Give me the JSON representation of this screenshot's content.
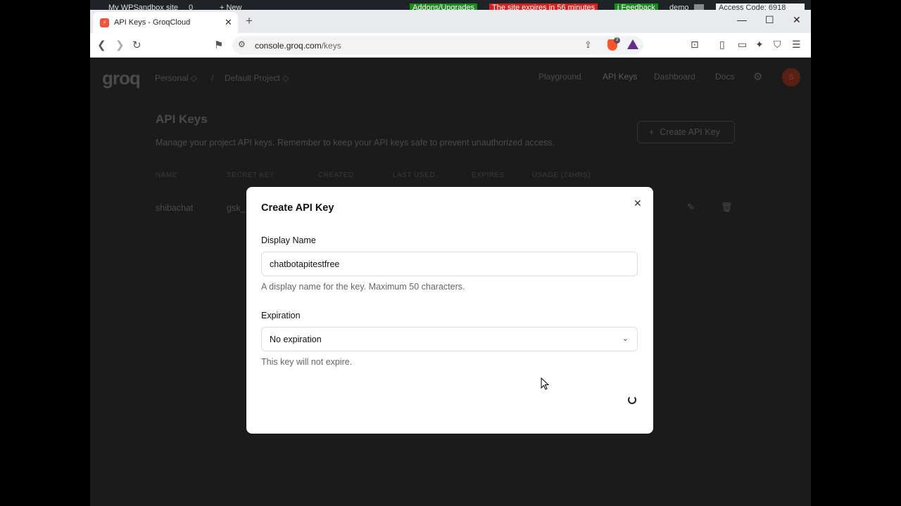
{
  "wpbar": {
    "site": "My WPSandbox site",
    "count": "0",
    "new": "+ New",
    "addons": "Addons/Upgrades",
    "expires": "The site expires in 56 minutes",
    "feedback": "i Feedback",
    "demo": "demo",
    "access": "Access Code: 6918"
  },
  "browser": {
    "tab_title": "API Keys - GroqCloud",
    "url_host": "console.groq.com",
    "url_path": "/keys",
    "brave_badge": "3"
  },
  "header": {
    "logo": "groq",
    "org": "Personal",
    "project": "Default Project",
    "nav": [
      "Playground",
      "API Keys",
      "Dashboard",
      "Docs"
    ],
    "avatar_initial": "S"
  },
  "main": {
    "title": "API Keys",
    "subtitle": "Manage your project API keys. Remember to keep your API keys safe to prevent unauthorized access.",
    "create_button": "Create API Key",
    "columns": [
      "NAME",
      "SECRET KEY",
      "CREATED",
      "LAST USED",
      "EXPIRES",
      "USAGE (24HRS)"
    ],
    "rows": [
      {
        "name": "shibachat",
        "secret": "gsk_"
      }
    ]
  },
  "modal": {
    "title": "Create API Key",
    "display_name_label": "Display Name",
    "display_name_value": "chatbotapitestfree",
    "display_name_hint": "A display name for the key. Maximum 50 characters.",
    "expiration_label": "Expiration",
    "expiration_value": "No expiration",
    "expiration_hint": "This key will not expire."
  }
}
